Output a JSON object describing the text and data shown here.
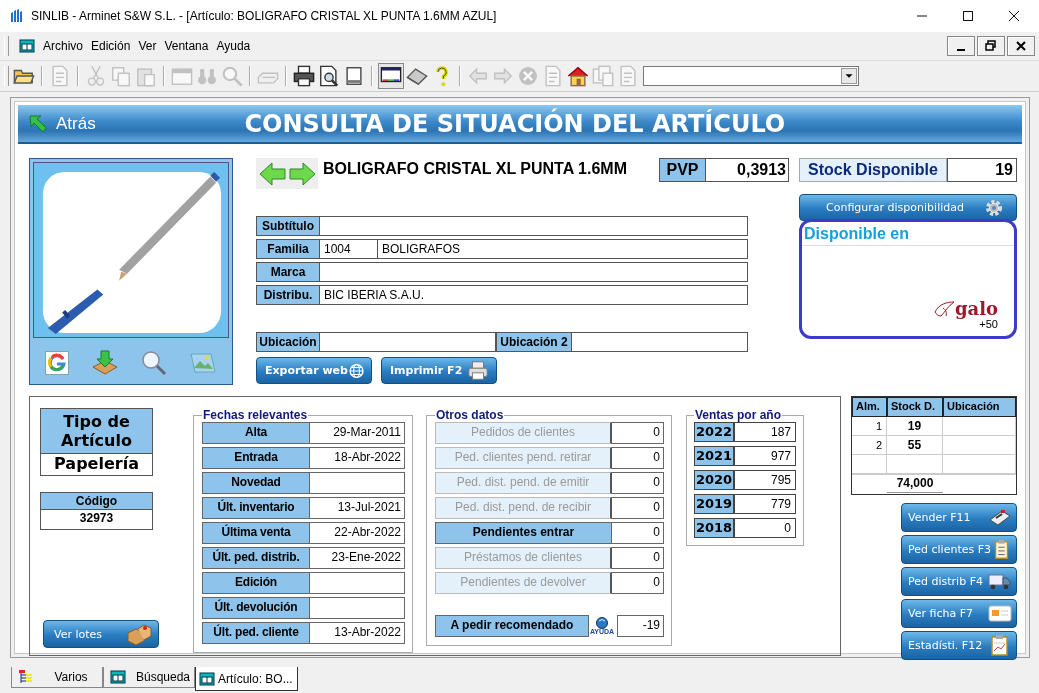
{
  "window": {
    "title": "SINLIB - Arminet S&W S.L. - [Artículo: BOLIGRAFO CRISTAL XL PUNTA 1.6MM AZUL]"
  },
  "menu": [
    "Archivo",
    "Edición",
    "Ver",
    "Ventana",
    "Ayuda"
  ],
  "toolbar": [
    {
      "kind": "folder",
      "disabled": false
    },
    {
      "kind": "separator"
    },
    {
      "kind": "document",
      "disabled": true
    },
    {
      "kind": "separator"
    },
    {
      "kind": "scissors",
      "disabled": true
    },
    {
      "kind": "copy",
      "disabled": true
    },
    {
      "kind": "paste",
      "disabled": true
    },
    {
      "kind": "separator"
    },
    {
      "kind": "window",
      "disabled": true
    },
    {
      "kind": "binoculars",
      "disabled": true
    },
    {
      "kind": "search",
      "disabled": true
    },
    {
      "kind": "separator"
    },
    {
      "kind": "keyboard",
      "disabled": true
    },
    {
      "kind": "separator"
    },
    {
      "kind": "printer",
      "disabled": false
    },
    {
      "kind": "print-preview",
      "disabled": false
    },
    {
      "kind": "page",
      "disabled": false
    },
    {
      "kind": "separator"
    },
    {
      "kind": "monitor",
      "disabled": false
    },
    {
      "kind": "eraser",
      "disabled": false
    },
    {
      "kind": "help",
      "disabled": false
    },
    {
      "kind": "separator"
    },
    {
      "kind": "back-arrow",
      "disabled": true
    },
    {
      "kind": "forward-arrow",
      "disabled": true
    },
    {
      "kind": "stop",
      "disabled": true
    },
    {
      "kind": "document",
      "disabled": true
    },
    {
      "kind": "home",
      "disabled": false
    },
    {
      "kind": "documents",
      "disabled": true
    },
    {
      "kind": "document",
      "disabled": true
    }
  ],
  "header": {
    "back": "Atrás",
    "title": "CONSULTA DE SITUACIÓN DEL ARTÍCULO"
  },
  "article": {
    "name": "BOLIGRAFO CRISTAL XL PUNTA 1.6MM",
    "price_label": "PVP",
    "price": "0,3913",
    "stock_label": "Stock Disponible",
    "stock": "19"
  },
  "fields": [
    {
      "label": "Subtítulo"
    },
    {
      "label": "Familia",
      "values": [
        "1004",
        "BOLIGRAFOS"
      ]
    },
    {
      "label": "Marca"
    },
    {
      "label": "Distribu.",
      "values": [
        "BIC IBERIA S.A.U."
      ]
    }
  ],
  "locations": [
    {
      "label": "Ubicación"
    },
    {
      "label": "Ubicación 2"
    }
  ],
  "actions": [
    "Exportar web",
    "Imprimir F2"
  ],
  "configure_button": "Configurar disponibilidad",
  "availability": {
    "title": "Disponible en",
    "store": {
      "logo": "galo",
      "count": "+50"
    }
  },
  "article_type": {
    "label": "Tipo de Artículo",
    "value": "Papelería"
  },
  "code": {
    "label": "Código",
    "value": "32973"
  },
  "lots_button": "Ver lotes",
  "dates": {
    "title": "Fechas relevantes",
    "rows": [
      {
        "label": "Alta",
        "value": "29-Mar-2011"
      },
      {
        "label": "Entrada",
        "value": "18-Abr-2022"
      },
      {
        "label": "Novedad"
      },
      {
        "label": "Últ. inventario",
        "value": "13-Jul-2021"
      },
      {
        "label": "Última venta",
        "value": "22-Abr-2022"
      },
      {
        "label": "Últ. ped. distrib.",
        "value": "23-Ene-2022"
      },
      {
        "label": "Edición"
      },
      {
        "label": "Últ. devolución"
      },
      {
        "label": "Últ. ped. cliente",
        "value": "13-Abr-2022"
      }
    ]
  },
  "other": {
    "title": "Otros datos",
    "rows": [
      {
        "label": "Pedidos de clientes",
        "value": "0",
        "disabled": true
      },
      {
        "label": "Ped. clientes pend. retirar",
        "value": "0",
        "disabled": true
      },
      {
        "label": "Ped. dist. pend. de emitir",
        "value": "0",
        "disabled": true
      },
      {
        "label": "Ped. dist. pend. de recibir",
        "value": "0",
        "disabled": true
      },
      {
        "label": "Pendientes entrar",
        "value": "0",
        "disabled": false
      },
      {
        "label": "Préstamos de clientes",
        "value": "0",
        "disabled": true
      },
      {
        "label": "Pendientes de devolver",
        "value": "0",
        "disabled": true
      }
    ],
    "recommended": {
      "label": "A pedir recomendado",
      "help": "AYUDA",
      "value": "-19"
    }
  },
  "sales": {
    "title": "Ventas por año",
    "rows": [
      {
        "year": "2022",
        "value": "187"
      },
      {
        "year": "2021",
        "value": "977"
      },
      {
        "year": "2020",
        "value": "795"
      },
      {
        "year": "2019",
        "value": "779"
      },
      {
        "year": "2018",
        "value": "0"
      }
    ]
  },
  "stock_table": {
    "columns": [
      "Alm.",
      "Stock D.",
      "Ubicación"
    ],
    "rows": [
      {
        "warehouse": "1",
        "stock": "19"
      },
      {
        "warehouse": "2",
        "stock": "55"
      }
    ],
    "total": "74,000"
  },
  "side_buttons": [
    "Vender F11",
    "Ped clientes F3",
    "Ped distrib F4",
    "Ver ficha F7",
    "Estadísti. F12"
  ],
  "tabs": [
    {
      "label": "Varios",
      "selected": false
    },
    {
      "label": "Búsqueda",
      "selected": false
    },
    {
      "label": "Artículo: BO...",
      "selected": true
    }
  ]
}
